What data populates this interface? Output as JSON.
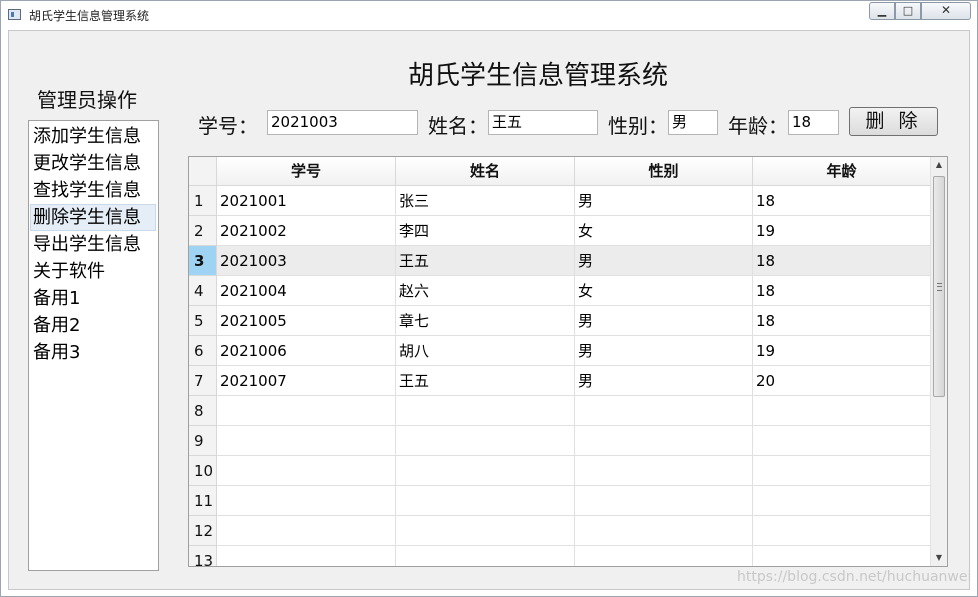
{
  "window": {
    "title": "胡氏学生信息管理系统",
    "minimize_icon": "minimize-icon",
    "maximize_icon": "maximize-icon",
    "close_icon": "close-icon"
  },
  "sidebar": {
    "title": "管理员操作",
    "items": [
      {
        "label": "添加学生信息"
      },
      {
        "label": "更改学生信息"
      },
      {
        "label": "查找学生信息"
      },
      {
        "label": "删除学生信息"
      },
      {
        "label": "导出学生信息"
      },
      {
        "label": "关于软件"
      },
      {
        "label": "备用1"
      },
      {
        "label": "备用2"
      },
      {
        "label": "备用3"
      }
    ],
    "selected_index": 3
  },
  "header": {
    "title": "胡氏学生信息管理系统",
    "id_label": "学号：",
    "id_value": "2021003",
    "name_label": "姓名：",
    "name_value": "王五",
    "gender_label": "性别：",
    "gender_value": "男",
    "age_label": "年龄：",
    "age_value": "18",
    "delete_label": "删 除"
  },
  "table": {
    "columns": [
      "学号",
      "姓名",
      "性别",
      "年龄"
    ],
    "rows": [
      [
        "2021001",
        "张三",
        "男",
        "18"
      ],
      [
        "2021002",
        "李四",
        "女",
        "19"
      ],
      [
        "2021003",
        "王五",
        "男",
        "18"
      ],
      [
        "2021004",
        "赵六",
        "女",
        "18"
      ],
      [
        "2021005",
        "章七",
        "男",
        "18"
      ],
      [
        "2021006",
        "胡八",
        "男",
        "19"
      ],
      [
        "2021007",
        "王五",
        "男",
        "20"
      ],
      [
        "",
        "",
        "",
        ""
      ],
      [
        "",
        "",
        "",
        ""
      ],
      [
        "",
        "",
        "",
        ""
      ],
      [
        "",
        "",
        "",
        ""
      ],
      [
        "",
        "",
        "",
        ""
      ],
      [
        "",
        "",
        "",
        ""
      ]
    ],
    "row_numbers": [
      "1",
      "2",
      "3",
      "4",
      "5",
      "6",
      "7",
      "8",
      "9",
      "10",
      "11",
      "12",
      "13"
    ],
    "current_row": 2
  },
  "watermark": "https://blog.csdn.net/huchuanwei",
  "colors": {
    "selection_header": "#9fd3f3",
    "current_row": "#ececec"
  }
}
